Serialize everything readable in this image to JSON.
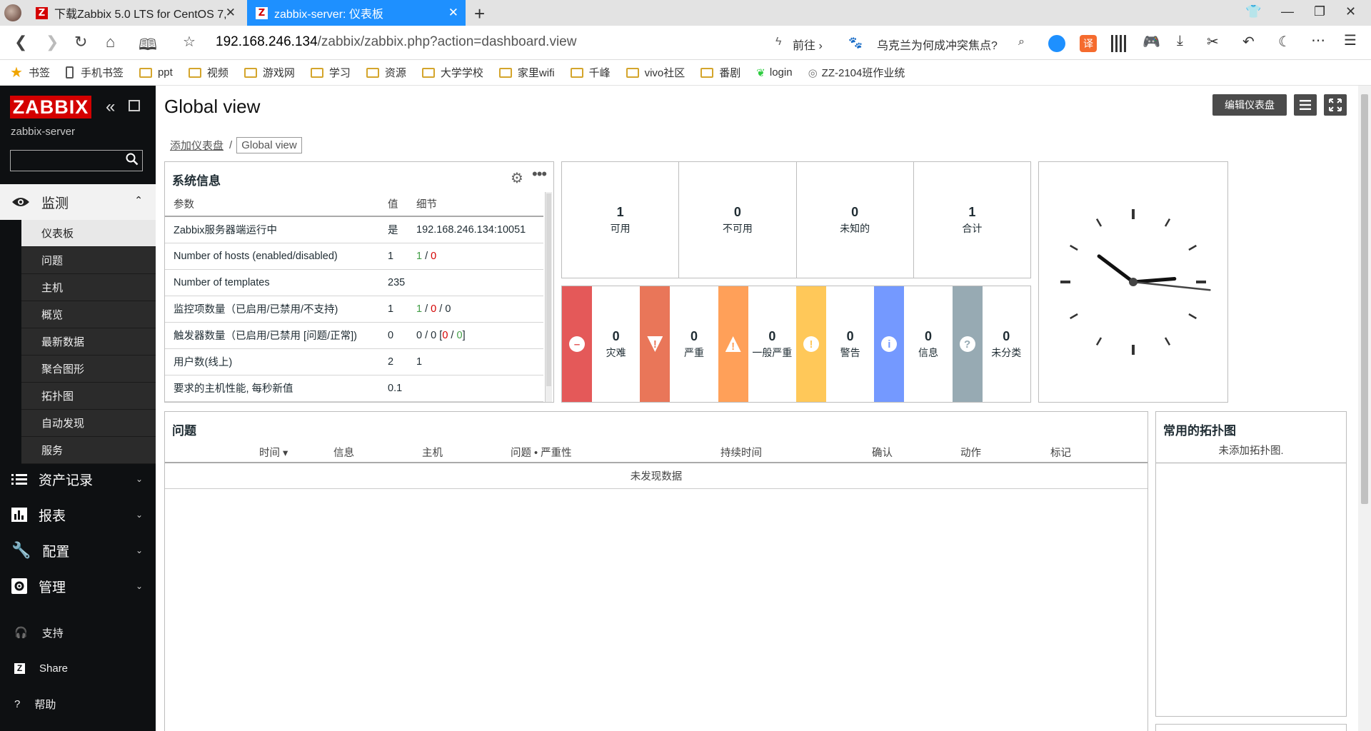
{
  "browser": {
    "tabs": [
      {
        "title": "下载Zabbix 5.0 LTS for CentOS 7,"
      },
      {
        "title": "zabbix-server: 仪表板"
      }
    ],
    "url_host": "192.168.246.134",
    "url_rest": "/zabbix/zabbix.php?action=dashboard.view",
    "forward_label": "前往",
    "search_suggestion": "乌克兰为何成冲突焦点?",
    "bookmarks": [
      "书签",
      "手机书签",
      "ppt",
      "视频",
      "游戏网",
      "学习",
      "资源",
      "大学学校",
      "家里wifi",
      "千峰",
      "vivo社区",
      "番剧",
      "login",
      "ZZ-2104班作业统"
    ]
  },
  "sidebar": {
    "logo": "ZABBIX",
    "server_name": "zabbix-server",
    "search_value": "",
    "monitoring": "监测",
    "submenu": [
      "仪表板",
      "问题",
      "主机",
      "概览",
      "最新数据",
      "聚合图形",
      "拓扑图",
      "自动发现",
      "服务"
    ],
    "inventory": "资产记录",
    "reports": "报表",
    "configuration": "配置",
    "administration": "管理",
    "support": "支持",
    "share": "Share",
    "help": "帮助"
  },
  "main": {
    "title": "Global view",
    "edit_button": "编辑仪表盘",
    "breadcrumb": [
      "添加仪表盘",
      "Global view"
    ]
  },
  "sysinfo": {
    "title": "系统信息",
    "headers": [
      "参数",
      "值",
      "细节"
    ],
    "rows": [
      {
        "param": "Zabbix服务器端运行中",
        "value": "是",
        "detail": "192.168.246.134:10051"
      },
      {
        "param": "Number of hosts (enabled/disabled)",
        "value": "1",
        "d1": "1",
        "d2": "0"
      },
      {
        "param": "Number of templates",
        "value": "235",
        "detail": ""
      },
      {
        "param": "监控项数量（已启用/已禁用/不支持)",
        "value": "1",
        "d1": "1",
        "d2": "0",
        "d3": "0"
      },
      {
        "param": "触发器数量（已启用/已禁用 [问题/正常])",
        "value": "0",
        "d1": "0",
        "d2": "0",
        "d3": "0",
        "d4": "0"
      },
      {
        "param": "用户数(线上)",
        "value": "2",
        "detail": "1"
      },
      {
        "param": "要求的主机性能, 每秒新值",
        "value": "0.1",
        "detail": ""
      }
    ]
  },
  "host_availability": [
    {
      "count": "1",
      "label": "可用"
    },
    {
      "count": "0",
      "label": "不可用"
    },
    {
      "count": "0",
      "label": "未知的"
    },
    {
      "count": "1",
      "label": "合计"
    }
  ],
  "severity": [
    {
      "count": "0",
      "label": "灾难",
      "color": "#e45959",
      "glyph": "–"
    },
    {
      "count": "0",
      "label": "严重",
      "color": "#e97659",
      "glyph": "!"
    },
    {
      "count": "0",
      "label": "一般严重",
      "color": "#ffa059",
      "glyph": "!"
    },
    {
      "count": "0",
      "label": "警告",
      "color": "#ffc859",
      "glyph": "!"
    },
    {
      "count": "0",
      "label": "信息",
      "color": "#7499ff",
      "glyph": "i"
    },
    {
      "count": "0",
      "label": "未分类",
      "color": "#97aab3",
      "glyph": "?"
    }
  ],
  "clock": {
    "hour": 10,
    "minute": 14,
    "second": 16
  },
  "problems": {
    "title": "问题",
    "headers": [
      "时间 ▾",
      "信息",
      "主机",
      "问题 • 严重性",
      "持续时间",
      "确认",
      "动作",
      "标记"
    ],
    "empty": "未发现数据"
  },
  "favmaps": {
    "title": "常用的拓扑图",
    "empty": "未添加拓扑图."
  }
}
